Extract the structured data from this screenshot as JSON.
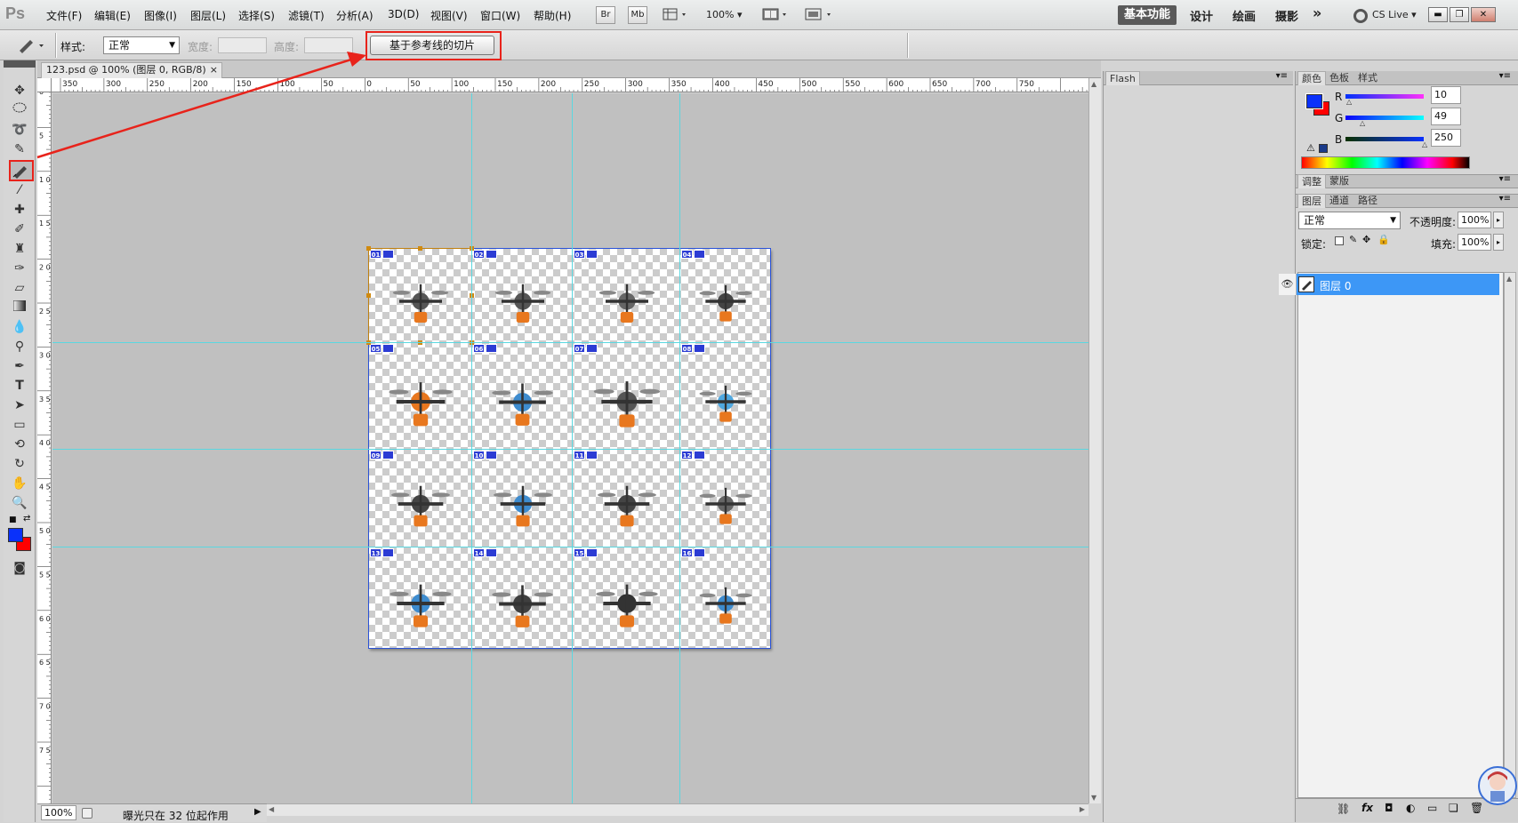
{
  "app": {
    "logo": "Ps"
  },
  "menu": [
    "文件(F)",
    "编辑(E)",
    "图像(I)",
    "图层(L)",
    "选择(S)",
    "滤镜(T)",
    "分析(A)",
    "3D(D)",
    "视图(V)",
    "窗口(W)",
    "帮助(H)"
  ],
  "appbar": {
    "br": "Br",
    "mb": "Mb",
    "zoom": "100%"
  },
  "workspaces": {
    "active": "基本功能",
    "items": [
      "设计",
      "绘画",
      "摄影"
    ],
    "more": "»",
    "cslive": "CS Live"
  },
  "options": {
    "style_label": "样式:",
    "style_value": "正常",
    "width_label": "宽度:",
    "height_label": "高度:",
    "slice_button": "基于参考线的切片"
  },
  "document": {
    "tab_title": "123.psd @ 100% (图层 0, RGB/8)",
    "close": "×"
  },
  "ruler_h": [
    "350",
    "300",
    "250",
    "200",
    "150",
    "100",
    "50",
    "0",
    "50",
    "100",
    "150",
    "200",
    "250",
    "300",
    "350",
    "400",
    "450",
    "500",
    "550",
    "600",
    "650",
    "700",
    "750"
  ],
  "ruler_v": [
    "0",
    "5",
    "1 0 0",
    "1 5 0",
    "2 0 0",
    "2 5 0",
    "3 0 0",
    "3 5 0",
    "4 0 0",
    "4 5 0",
    "5 0 0",
    "5 5 0",
    "6 0 0",
    "6 5 0",
    "7 0 0",
    "7 5 0"
  ],
  "slices": [
    "01",
    "02",
    "03",
    "04",
    "05",
    "06",
    "07",
    "08",
    "09",
    "10",
    "11",
    "12",
    "13",
    "14",
    "15",
    "16"
  ],
  "status": {
    "zoom": "100%",
    "text": "曝光只在 32 位起作用"
  },
  "flash_panel": {
    "title": "Flash"
  },
  "color_panel": {
    "tabs": [
      "颜色",
      "色板",
      "样式"
    ],
    "channels": [
      {
        "label": "R",
        "value": "10"
      },
      {
        "label": "G",
        "value": "49"
      },
      {
        "label": "B",
        "value": "250"
      }
    ],
    "foreground": "#0a31fa",
    "background": "#ff0000"
  },
  "adjust_panel": {
    "tabs": [
      "调整",
      "蒙版"
    ]
  },
  "layers_panel": {
    "tabs": [
      "图层",
      "通道",
      "路径"
    ],
    "blend_mode": "正常",
    "opacity_label": "不透明度:",
    "opacity_value": "100%",
    "lock_label": "锁定:",
    "fill_label": "填充:",
    "fill_value": "100%",
    "layers": [
      {
        "name": "图层 0"
      }
    ]
  },
  "colors": {
    "accent": "#3d97f6",
    "annotation": "#e8231b",
    "guide": "#5ad7e0",
    "slice": "#2a52d8"
  }
}
